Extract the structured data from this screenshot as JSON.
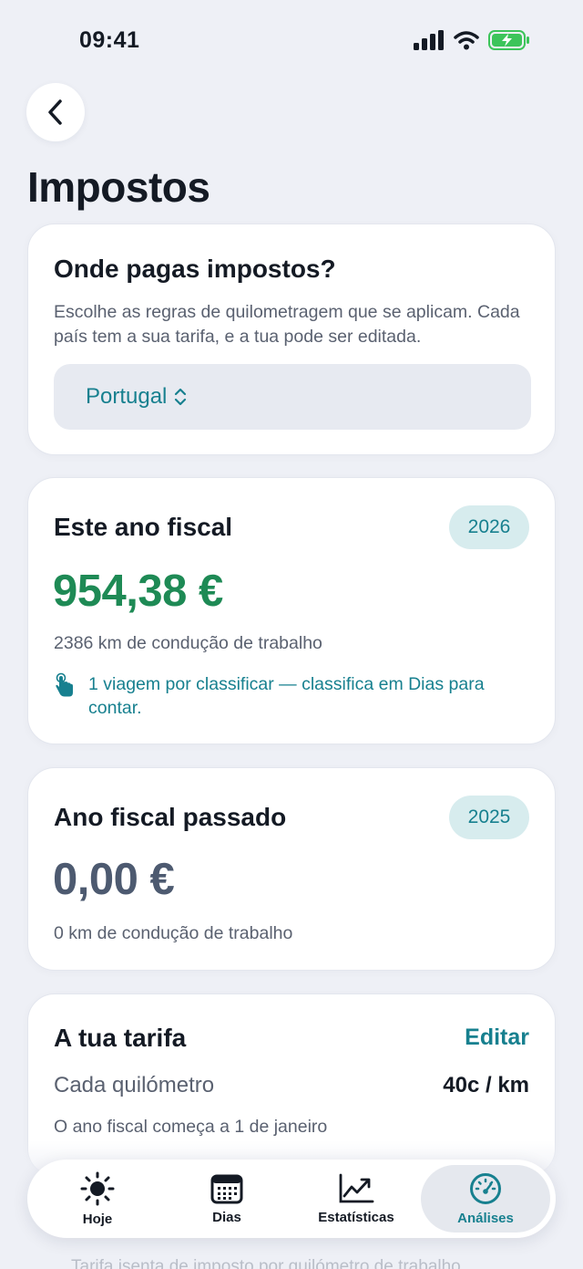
{
  "status_bar": {
    "time": "09:41"
  },
  "header": {
    "title": "Impostos",
    "back_icon": "chevron-left-icon"
  },
  "tax_country_card": {
    "title": "Onde pagas impostos?",
    "description": "Escolhe as regras de quilometragem que se aplicam. Cada país tem a sua tarifa, e a tua pode ser editada.",
    "selected_country": "Portugal"
  },
  "this_fiscal_year": {
    "title": "Este ano fiscal",
    "year": "2026",
    "amount": "954,38 €",
    "km_text": "2386 km de condução de trabalho",
    "notice": "1 viagem por classificar — classifica em Dias para contar."
  },
  "last_fiscal_year": {
    "title": "Ano fiscal passado",
    "year": "2025",
    "amount": "0,00 €",
    "km_text": "0 km de condução de trabalho"
  },
  "rate_card": {
    "title": "A tua tarifa",
    "edit_label": "Editar",
    "rate_label": "Cada quilómetro",
    "rate_value": "40c / km",
    "fiscal_note": "O ano fiscal começa a 1 de janeiro"
  },
  "faded_footer_text": "Tarifa isenta de imposto por quilómetro de trabalho",
  "tab_bar": {
    "tabs": [
      {
        "label": "Hoje",
        "icon": "sun-icon",
        "active": false
      },
      {
        "label": "Dias",
        "icon": "calendar-icon",
        "active": false
      },
      {
        "label": "Estatísticas",
        "icon": "chart-icon",
        "active": false
      },
      {
        "label": "Análises",
        "icon": "gauge-icon",
        "active": true
      }
    ]
  },
  "colors": {
    "accent": "#17808f",
    "positive": "#1e8a55",
    "neutral_amount": "#4d5a70",
    "background": "#eef0f6"
  }
}
